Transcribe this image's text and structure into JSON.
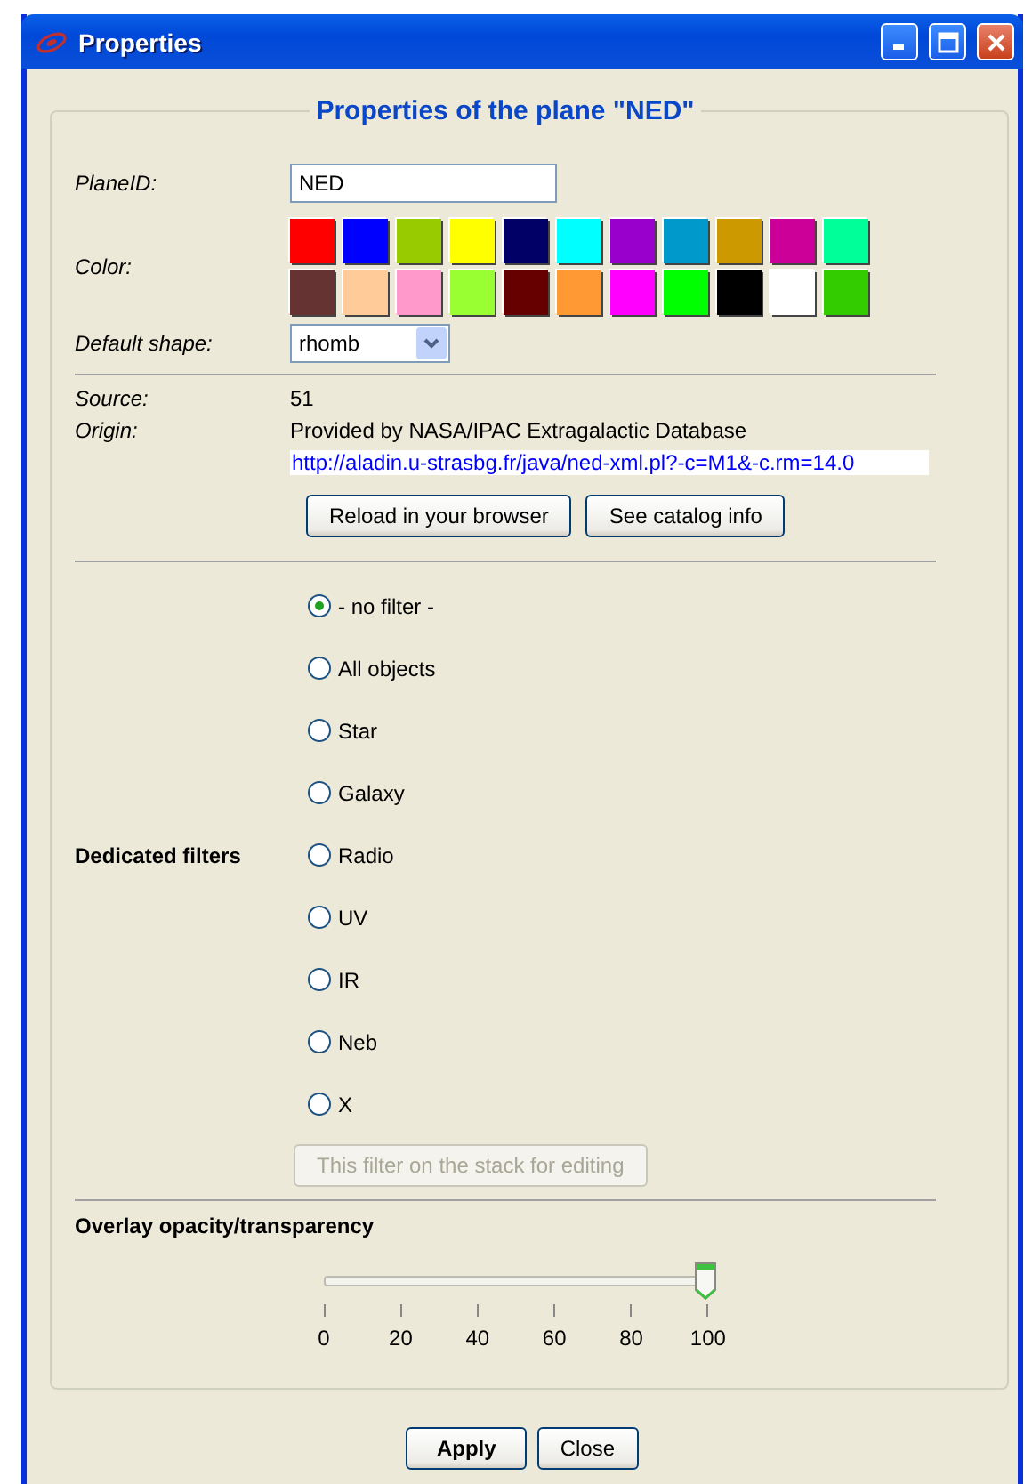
{
  "window": {
    "title": "Properties"
  },
  "group_title": "Properties of the plane \"NED\"",
  "plane_id": {
    "label": "PlaneID:",
    "value": "NED"
  },
  "color": {
    "label": "Color:",
    "swatches": [
      {
        "color": "#ff0000"
      },
      {
        "color": "#0000ff"
      },
      {
        "color": "#99cc00"
      },
      {
        "color": "#ffff00"
      },
      {
        "color": "#000066"
      },
      {
        "color": "#00ffff"
      },
      {
        "color": "#9900cc"
      },
      {
        "color": "#0099cc"
      },
      {
        "color": "#cc9900"
      },
      {
        "color": "#cc0099"
      },
      {
        "color": "#00ff99"
      },
      {
        "color": "#663333"
      },
      {
        "color": "#ffcc99"
      },
      {
        "color": "#ff99cc"
      },
      {
        "color": "#99ff33"
      },
      {
        "color": "#660000"
      },
      {
        "color": "#ff9933"
      },
      {
        "color": "#ff00ff"
      },
      {
        "color": "#00ff00"
      },
      {
        "color": "#000000"
      },
      {
        "color": "#ffffff"
      },
      {
        "color": "#33cc00"
      }
    ]
  },
  "default_shape": {
    "label": "Default shape:",
    "value": "rhomb"
  },
  "source": {
    "label": "Source:",
    "value": "51"
  },
  "origin": {
    "label": "Origin:",
    "value": "Provided by NASA/IPAC Extragalactic Database",
    "url": "http://aladin.u-strasbg.fr/java/ned-xml.pl?-c=M1&-c.rm=14.0"
  },
  "origin_buttons": [
    "Reload in your browser",
    "See catalog info"
  ],
  "filters": {
    "label": "Dedicated filters",
    "options": [
      {
        "label": "- no filter -",
        "selected": true
      },
      {
        "label": "All objects",
        "selected": false
      },
      {
        "label": "Star",
        "selected": false
      },
      {
        "label": "Galaxy",
        "selected": false
      },
      {
        "label": "Radio",
        "selected": false
      },
      {
        "label": "UV",
        "selected": false
      },
      {
        "label": "IR",
        "selected": false
      },
      {
        "label": "Neb",
        "selected": false
      },
      {
        "label": "X",
        "selected": false
      }
    ],
    "edit_button": {
      "label": "This filter on the stack for editing",
      "disabled": true
    }
  },
  "opacity": {
    "label": "Overlay opacity/transparency",
    "level": 1,
    "ticks": [
      "0",
      "20",
      "40",
      "60",
      "80",
      "100"
    ]
  },
  "buttons": [
    {
      "label": "Apply",
      "default": true
    },
    {
      "label": "Close",
      "default": false
    }
  ]
}
